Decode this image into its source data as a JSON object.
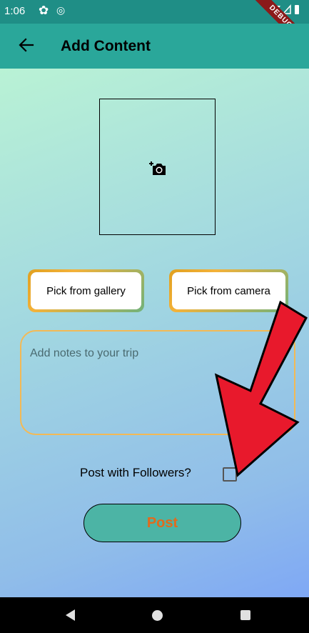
{
  "status_bar": {
    "time": "1:06",
    "debug_label": "DEBUG"
  },
  "app_bar": {
    "title": "Add Content"
  },
  "image_picker": {
    "icon": "add-a-photo-icon"
  },
  "buttons": {
    "pick_gallery": "Pick from gallery",
    "pick_camera": "Pick from camera",
    "post": "Post"
  },
  "notes": {
    "placeholder": "Add notes to your trip",
    "value": ""
  },
  "followers": {
    "label": "Post with Followers?",
    "checked": false
  },
  "colors": {
    "app_bar": "#2aa79a",
    "status_bar": "#1f8e86",
    "post_button": "#4cb4a5",
    "post_text": "#e26a1c",
    "notes_border": "#f3b955",
    "arrow": "#e8192c"
  }
}
